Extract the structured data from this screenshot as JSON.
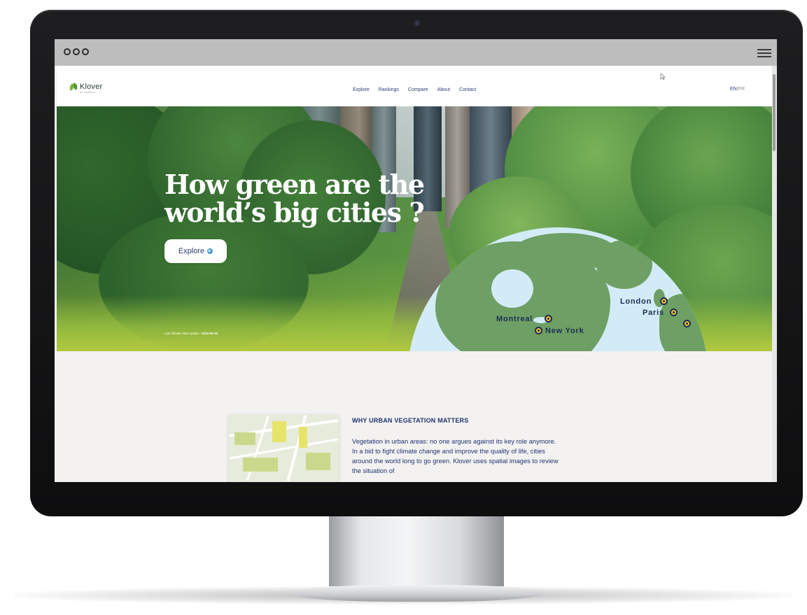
{
  "window": {
    "controls": [
      "close",
      "minimize",
      "maximize"
    ],
    "menu_icon": "hamburger-menu-icon"
  },
  "nav": {
    "logo_text": "Klover",
    "logo_sub": "BY KERMAN",
    "links": [
      "Explore",
      "Rankings",
      "Compare",
      "About",
      "Contact"
    ],
    "lang_en": "EN",
    "lang_sep": "/",
    "lang_fr": "FR"
  },
  "hero": {
    "title_line1": "How green are the",
    "title_line2": "world’s big cities ?",
    "explore_label": "Explore",
    "update_label": "Last climate data update :",
    "update_date": "2022-05-18",
    "cities": [
      "Montreal",
      "New York",
      "London",
      "Paris"
    ]
  },
  "section": {
    "title": "WHY URBAN VEGETATION MATTERS",
    "body": "Vegetation in urban areas: no one argues against its key role anymore. In a bid to fight climate change and improve the quality of life, cities around the world long to go green. Klover uses spatial images to review the situation of"
  },
  "colors": {
    "navy": "#1f3470",
    "green": "#5d9a45",
    "lime": "#a8c240",
    "pin": "#f2c230"
  }
}
